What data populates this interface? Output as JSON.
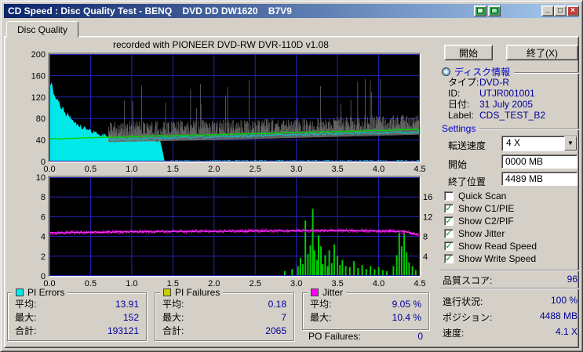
{
  "window": {
    "title": "CD Speed : Disc Quality Test - BENQ    DVD DD DW1620    B7V9",
    "tab": "Disc Quality"
  },
  "icons": {
    "minimize": "_",
    "maximize": "□",
    "close": "×"
  },
  "buttons": {
    "start": "開始",
    "exit": "終了(X)"
  },
  "disc_info": {
    "header": "ディスク情報",
    "rows": [
      {
        "label": "タイプ:",
        "value": "DVD-R"
      },
      {
        "label": "ID:",
        "value": "UTJR001001"
      },
      {
        "label": "日付:",
        "value": "31 July 2005"
      },
      {
        "label": "Label:",
        "value": "CDS_TEST_B2"
      }
    ]
  },
  "settings": {
    "header": "Settings",
    "speed_label": "転送速度",
    "speed_value": "4 X",
    "start_label": "開始",
    "start_value": "0000 MB",
    "end_label": "終了位置",
    "end_value": "4489 MB",
    "checkboxes": [
      {
        "label": "Quick Scan",
        "checked": false
      },
      {
        "label": "Show C1/PIE",
        "checked": true
      },
      {
        "label": "Show C2/PIF",
        "checked": true
      },
      {
        "label": "Show Jitter",
        "checked": true
      },
      {
        "label": "Show Read Speed",
        "checked": true
      },
      {
        "label": "Show Write Speed",
        "checked": true
      }
    ]
  },
  "status": {
    "score_label": "品質スコア:",
    "score_value": "96",
    "progress_label": "進行状況:",
    "progress_value": "100 %",
    "position_label": "ポジション:",
    "position_value": "4488 MB",
    "speed_label": "速度:",
    "speed_value": "4.1 X"
  },
  "stats_panels": [
    {
      "name": "PI Errors",
      "color": "#00e8e8",
      "rows": [
        [
          "平均:",
          "13.91"
        ],
        [
          "最大:",
          "152"
        ],
        [
          "合計:",
          "193121"
        ]
      ]
    },
    {
      "name": "PI Failures",
      "color": "#cccc00",
      "rows": [
        [
          "平均:",
          "0.18"
        ],
        [
          "最大:",
          "7"
        ],
        [
          "合計:",
          "2065"
        ]
      ]
    },
    {
      "name": "Jitter",
      "color": "#ff00ff",
      "rows": [
        [
          "平均:",
          "9.05 %"
        ],
        [
          "最大:",
          "10.4 %"
        ]
      ]
    }
  ],
  "po_failures": {
    "label": "PO Failures:",
    "value": "0"
  },
  "chart_data": [
    {
      "id": "quality-top",
      "type": "area",
      "title": "recorded with PIONEER DVD-RW  DVR-110D v1.08",
      "xlim": [
        0,
        4.5
      ],
      "ylim": [
        0,
        200
      ],
      "x_ticks": [
        "0.0",
        "0.5",
        "1.0",
        "1.5",
        "2.0",
        "2.5",
        "3.0",
        "3.5",
        "4.0",
        "4.5"
      ],
      "y_ticks": [
        "0",
        "40",
        "80",
        "120",
        "160",
        "200"
      ],
      "grid": true,
      "series": [
        {
          "name": "pi-errors-area",
          "type": "area",
          "color": "#00e8e8",
          "noise": 5,
          "step": 0.01,
          "points": [
            [
              0,
              140
            ],
            [
              0.02,
              150
            ],
            [
              0.05,
              128
            ],
            [
              0.08,
              118
            ],
            [
              0.1,
              112
            ],
            [
              0.15,
              100
            ],
            [
              0.2,
              90
            ],
            [
              0.25,
              82
            ],
            [
              0.3,
              76
            ],
            [
              0.35,
              69
            ],
            [
              0.4,
              64
            ],
            [
              0.45,
              60
            ],
            [
              0.5,
              57
            ],
            [
              0.6,
              52
            ],
            [
              0.7,
              49
            ],
            [
              0.8,
              47
            ],
            [
              0.9,
              46
            ],
            [
              1.0,
              45
            ],
            [
              1.1,
              44
            ],
            [
              1.2,
              43
            ],
            [
              1.3,
              41
            ],
            [
              1.35,
              38
            ],
            [
              1.4,
              2
            ],
            [
              4.5,
              2
            ]
          ]
        },
        {
          "name": "pie-noise-band",
          "type": "band",
          "color": "#6e6e6e",
          "step": 0.0055,
          "base": [
            [
              0.72,
              40
            ],
            [
              2.0,
              44
            ],
            [
              3.0,
              48
            ],
            [
              4.5,
              54
            ]
          ],
          "hmin": 5,
          "hmax": 34,
          "spike_p": 0.02,
          "spike_h": 110
        },
        {
          "name": "c1-pie-line",
          "type": "line",
          "color": "#00cccc",
          "width": 1,
          "noise": 2.2,
          "step": 0.012,
          "points": [
            [
              0.72,
              41
            ],
            [
              2.5,
              48
            ],
            [
              4.5,
              55
            ]
          ]
        },
        {
          "name": "write-speed-line",
          "type": "line",
          "color": "#00d400",
          "width": 1.4,
          "noise": 1,
          "step": 0.02,
          "points": [
            [
              0,
              42
            ],
            [
              1,
              46
            ],
            [
              2,
              50
            ],
            [
              3,
              54
            ],
            [
              4,
              58
            ],
            [
              4.5,
              60
            ]
          ]
        }
      ]
    },
    {
      "id": "quality-bottom",
      "type": "line",
      "xlim": [
        0,
        4.5
      ],
      "ylim": [
        0,
        10
      ],
      "y2lim": [
        0,
        20
      ],
      "x_ticks": [
        "0.0",
        "0.5",
        "1.0",
        "1.5",
        "2.0",
        "2.5",
        "3.0",
        "3.5",
        "4.0",
        "4.5"
      ],
      "y_ticks": [
        "0",
        "2",
        "4",
        "6",
        "8",
        "10"
      ],
      "y2_ticks": [
        [
          4,
          "4"
        ],
        [
          8,
          "8"
        ],
        [
          12,
          "12"
        ],
        [
          16,
          "16"
        ]
      ],
      "grid": true,
      "series": [
        {
          "name": "pi-failures-bars",
          "type": "bars",
          "color": "#00cc00",
          "width": 2,
          "bars": [
            [
              2.86,
              0.5
            ],
            [
              2.95,
              0.7
            ],
            [
              3.02,
              1.0
            ],
            [
              3.05,
              1.8
            ],
            [
              3.08,
              1.2
            ],
            [
              3.11,
              5.6
            ],
            [
              3.14,
              2.2
            ],
            [
              3.17,
              3.1
            ],
            [
              3.2,
              6.8
            ],
            [
              3.22,
              2.6
            ],
            [
              3.25,
              1.6
            ],
            [
              3.27,
              4.1
            ],
            [
              3.3,
              3.0
            ],
            [
              3.32,
              1.2
            ],
            [
              3.35,
              2.1
            ],
            [
              3.38,
              1.0
            ],
            [
              3.4,
              2.6
            ],
            [
              3.43,
              1.3
            ],
            [
              3.46,
              3.2
            ],
            [
              3.5,
              2.0
            ],
            [
              3.53,
              1.1
            ],
            [
              3.56,
              1.6
            ],
            [
              3.6,
              1.0
            ],
            [
              3.65,
              0.9
            ],
            [
              3.7,
              1.5
            ],
            [
              3.75,
              0.8
            ],
            [
              3.8,
              1.1
            ],
            [
              3.85,
              0.7
            ],
            [
              3.9,
              1.0
            ],
            [
              3.95,
              0.7
            ],
            [
              4.0,
              0.9
            ],
            [
              4.05,
              0.6
            ],
            [
              4.1,
              0.5
            ],
            [
              4.18,
              1.0
            ],
            [
              4.22,
              2.1
            ],
            [
              4.25,
              4.4
            ],
            [
              4.28,
              3.0
            ],
            [
              4.31,
              4.6
            ],
            [
              4.34,
              2.4
            ],
            [
              4.37,
              1.4
            ],
            [
              4.41,
              1.0
            ],
            [
              4.45,
              0.6
            ]
          ]
        },
        {
          "name": "jitter-noise",
          "type": "line",
          "axis": "y2",
          "color": "#b000b0",
          "width": 1,
          "noise": 0.4,
          "step": 0.008,
          "points": [
            [
              0,
              8.7
            ],
            [
              0.5,
              8.85
            ],
            [
              1,
              8.95
            ],
            [
              1.5,
              9.0
            ],
            [
              2,
              9.05
            ],
            [
              2.5,
              9.1
            ],
            [
              3,
              9.15
            ],
            [
              3.5,
              9.2
            ],
            [
              4,
              9.1
            ],
            [
              4.3,
              9.0
            ],
            [
              4.42,
              8.6
            ],
            [
              4.5,
              8.4
            ]
          ]
        },
        {
          "name": "jitter-line",
          "type": "line",
          "axis": "y2",
          "color": "#ff30ff",
          "width": 1.3,
          "noise": 0.12,
          "step": 0.01,
          "points": [
            [
              0,
              8.7
            ],
            [
              0.5,
              8.85
            ],
            [
              1,
              8.95
            ],
            [
              1.5,
              9.0
            ],
            [
              2,
              9.05
            ],
            [
              2.5,
              9.1
            ],
            [
              3,
              9.15
            ],
            [
              3.5,
              9.2
            ],
            [
              4,
              9.1
            ],
            [
              4.3,
              9.0
            ],
            [
              4.42,
              8.6
            ],
            [
              4.5,
              8.4
            ]
          ]
        }
      ]
    }
  ]
}
